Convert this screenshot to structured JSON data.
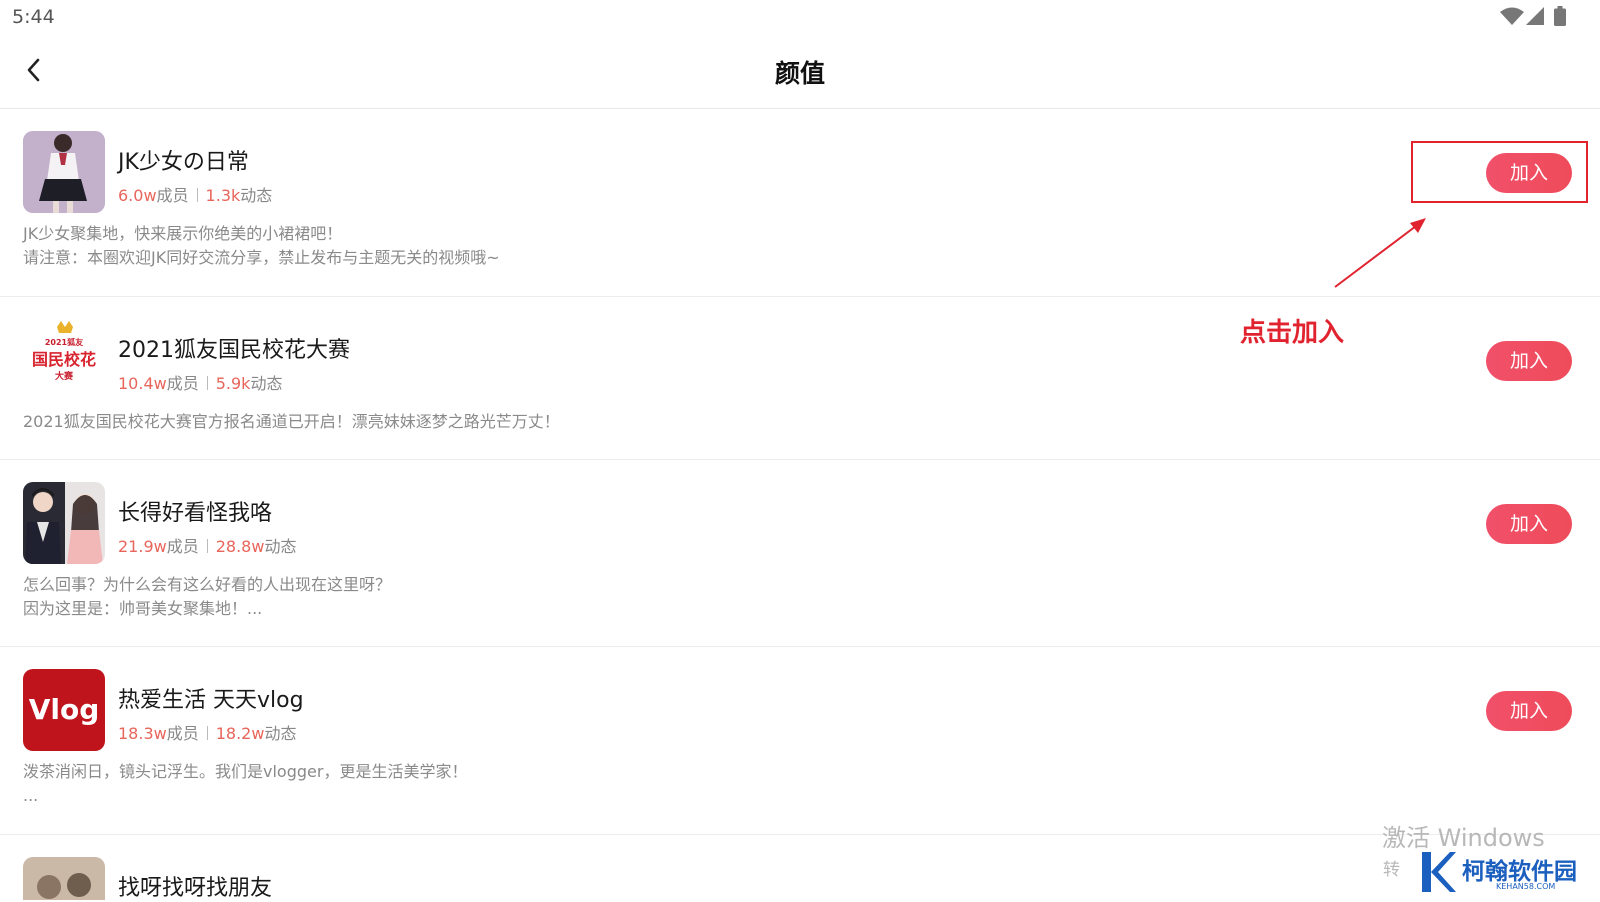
{
  "status_bar": {
    "time": "5:44"
  },
  "header": {
    "title": "颜值"
  },
  "groups": [
    {
      "name": "JK少女の日常",
      "members": "6.0w",
      "members_label": "成员",
      "posts": "1.3k",
      "posts_label": "动态",
      "desc_line1": "JK少女聚集地，快来展示你绝美的小裙裙吧！",
      "desc_line2": "请注意：本圈欢迎JK同好交流分享，禁止发布与主题无关的视频哦~",
      "join_label": "加入"
    },
    {
      "name": "2021狐友国民校花大赛",
      "members": "10.4w",
      "members_label": "成员",
      "posts": "5.9k",
      "posts_label": "动态",
      "desc_line1": "2021狐友国民校花大赛官方报名通道已开启！漂亮妹妹逐梦之路光芒万丈！",
      "desc_line2": "",
      "join_label": "加入",
      "logo_text_top": "2021狐友",
      "logo_text_main": "国民校花",
      "logo_text_bottom": "大赛"
    },
    {
      "name": "长得好看怪我咯",
      "members": "21.9w",
      "members_label": "成员",
      "posts": "28.8w",
      "posts_label": "动态",
      "desc_line1": "怎么回事？为什么会有这么好看的人出现在这里呀？",
      "desc_line2": "因为这里是：帅哥美女聚集地！...",
      "join_label": "加入"
    },
    {
      "name": "热爱生活 天天vlog",
      "members": "18.3w",
      "members_label": "成员",
      "posts": "18.2w",
      "posts_label": "动态",
      "desc_line1": "泼茶消闲日，镜头记浮生。我们是vlogger，更是生活美学家！",
      "desc_line2": "...",
      "join_label": "加入",
      "logo_text": "Vlog"
    },
    {
      "name": "找呀找呀找朋友"
    }
  ],
  "annotation": {
    "label": "点击加入",
    "color": "#e0232f"
  },
  "watermark": {
    "line1": "激活 Windows",
    "line2": "转"
  },
  "brand": {
    "name": "柯翰软件园",
    "url": "KEHAN58.COM"
  },
  "colors": {
    "accent": "#ef4b5a",
    "stat_number": "#e8655b"
  }
}
